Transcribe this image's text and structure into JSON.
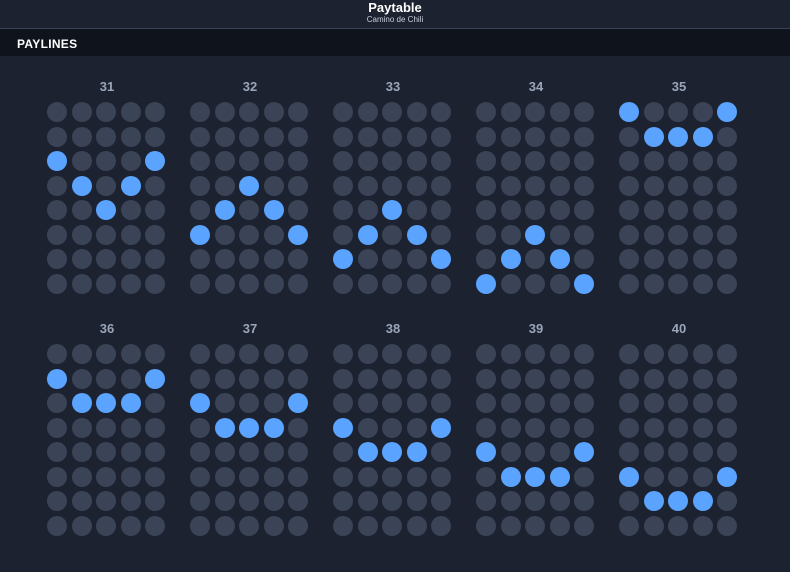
{
  "header": {
    "title": "Paytable",
    "subtitle": "Camino de Chili"
  },
  "section": {
    "title": "PAYLINES"
  },
  "colors": {
    "active": "#5aa3ff",
    "inactive": "#3a4456"
  },
  "paylines": [
    {
      "number": "31",
      "rows": [
        2,
        3,
        4,
        3,
        2
      ]
    },
    {
      "number": "32",
      "rows": [
        5,
        4,
        3,
        4,
        5
      ]
    },
    {
      "number": "33",
      "rows": [
        6,
        5,
        4,
        5,
        6
      ]
    },
    {
      "number": "34",
      "rows": [
        7,
        6,
        5,
        6,
        7
      ]
    },
    {
      "number": "35",
      "rows": [
        0,
        1,
        1,
        1,
        0
      ]
    },
    {
      "number": "36",
      "rows": [
        1,
        2,
        2,
        2,
        1
      ]
    },
    {
      "number": "37",
      "rows": [
        2,
        3,
        3,
        3,
        2
      ]
    },
    {
      "number": "38",
      "rows": [
        3,
        4,
        4,
        4,
        3
      ]
    },
    {
      "number": "39",
      "rows": [
        4,
        5,
        5,
        5,
        4
      ]
    },
    {
      "number": "40",
      "rows": [
        5,
        6,
        6,
        6,
        5
      ]
    }
  ]
}
